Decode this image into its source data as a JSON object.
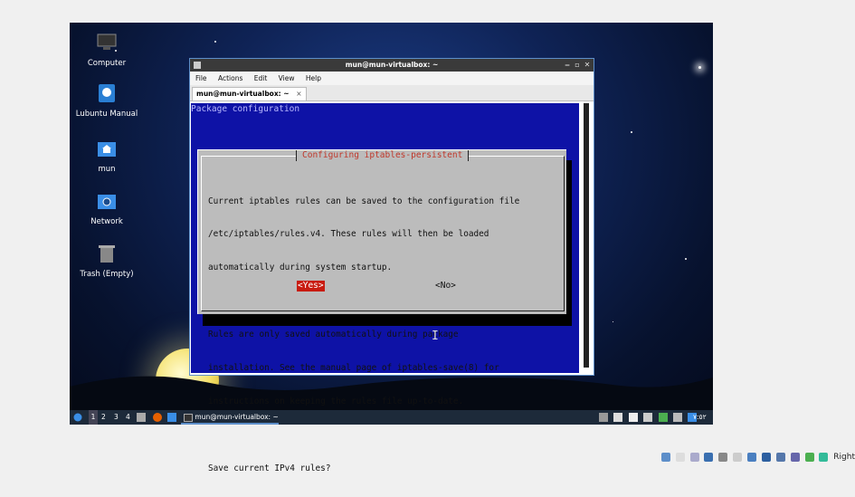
{
  "desktop": {
    "icons": [
      {
        "label": "Computer",
        "icon": "computer-icon"
      },
      {
        "label": "Lubuntu Manual",
        "icon": "manual-icon"
      },
      {
        "label": "mun",
        "icon": "home-folder-icon"
      },
      {
        "label": "Network",
        "icon": "network-icon"
      },
      {
        "label": "Trash (Empty)",
        "icon": "trash-icon"
      }
    ]
  },
  "terminal": {
    "title": "mun@mun-virtualbox: ~",
    "menu": [
      "File",
      "Actions",
      "Edit",
      "View",
      "Help"
    ],
    "tab_label": "mun@mun-virtualbox: ~",
    "tab_close": "×",
    "package_config_title": "Package configuration",
    "dialog": {
      "title": "Configuring iptables-persistent",
      "body_lines": [
        "Current iptables rules can be saved to the configuration file",
        "/etc/iptables/rules.v4. These rules will then be loaded",
        "automatically during system startup.",
        "",
        "Rules are only saved automatically during package",
        "installation. See the manual page of iptables-save(8) for",
        "instructions on keeping the rules file up-to-date.",
        "",
        "Save current IPv4 rules?"
      ],
      "yes_label": "<Yes>",
      "no_label": "<No>"
    }
  },
  "taskbar": {
    "workspaces": [
      "1",
      "2",
      "3",
      "4"
    ],
    "active_window": "mun@mun-virtualbox: ~",
    "clock": "٧:٥٢"
  },
  "host_tray": {
    "label": "Right"
  },
  "colors": {
    "dialog_bg": "#bcbcbc",
    "terminal_bg": "#0e12a6",
    "title_red": "#c0392b",
    "yes_bg": "#c81b10"
  }
}
